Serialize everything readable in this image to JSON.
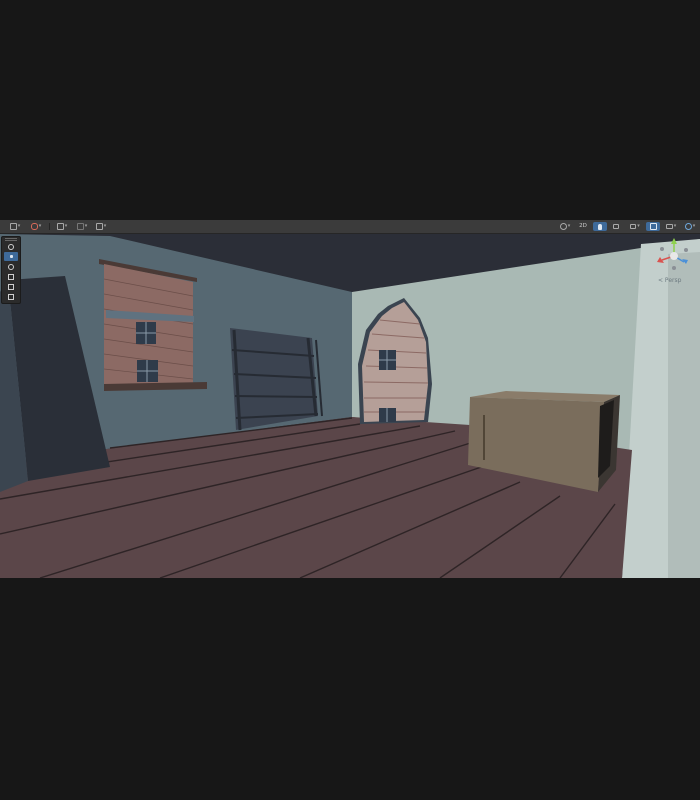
{
  "toolbar": {
    "left_items": [
      {
        "name": "hand-tool-dropdown",
        "icon": "grid-icon"
      },
      {
        "name": "gizmo-dropdown",
        "icon": "gizmo-icon"
      },
      {
        "name": "pivot-dropdown",
        "icon": "pivot-icon"
      },
      {
        "name": "global-dropdown",
        "icon": "global-icon"
      },
      {
        "name": "snap-dropdown",
        "icon": "snap-icon"
      }
    ],
    "right_items": [
      {
        "name": "draw-mode-dropdown",
        "icon": "sphere-icon"
      },
      {
        "name": "2d-toggle",
        "label": "2D"
      },
      {
        "name": "lighting-toggle",
        "icon": "lightbulb-icon",
        "active": true
      },
      {
        "name": "audio-toggle",
        "icon": "speaker-icon"
      },
      {
        "name": "effects-dropdown",
        "icon": "effects-icon"
      },
      {
        "name": "hidden-objects-toggle",
        "icon": "eye-off-icon",
        "active": true
      },
      {
        "name": "camera-dropdown",
        "icon": "camera-icon"
      },
      {
        "name": "gizmos-dropdown",
        "icon": "globe-icon"
      }
    ]
  },
  "tools_palette": [
    "view-tool",
    "move-tool",
    "rotate-tool",
    "scale-tool",
    "rect-tool",
    "transform-tool"
  ],
  "active_tool": "move-tool",
  "gizmo": {
    "label": "< Persp",
    "colors": {
      "x": "#d9534f",
      "y": "#8fd14f",
      "z": "#4a90d9"
    }
  },
  "scene": {
    "colors": {
      "ceiling": "#2b2e37",
      "left_wall": "#566872",
      "back_wall": "#4d5f69",
      "right_wall": "#a9b9b4",
      "floor": "#5b4649",
      "floor_lines": "#2e2426",
      "brick": "#8c6a64",
      "crate": "#7a6d5c"
    }
  }
}
